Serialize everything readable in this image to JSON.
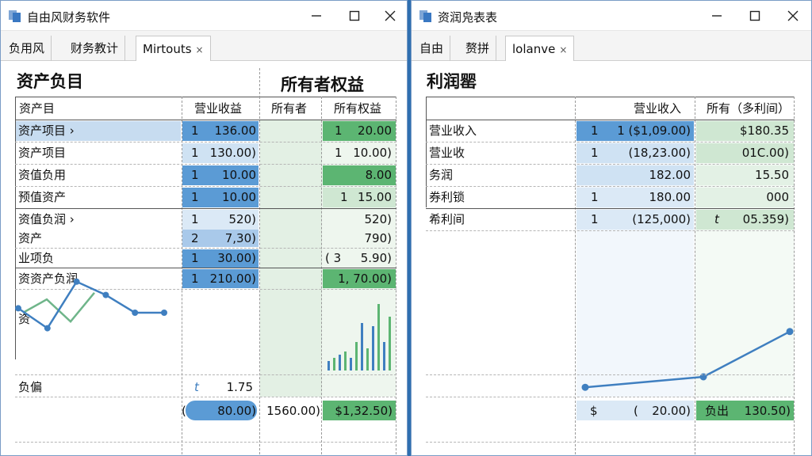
{
  "windows": [
    {
      "title": "自由风财务软件",
      "tabs": [
        {
          "label": "负用风"
        },
        {
          "label": "财务教计"
        },
        {
          "label": "Mirtouts",
          "close": "×"
        }
      ],
      "section_title": "资产负目",
      "equity_title": "所有者权益",
      "headers": {
        "account": "资产目",
        "col1": "营业收益",
        "col2": "所有者",
        "col3": "所有权益"
      },
      "rows": [
        {
          "label": "资产项目 ›",
          "c1_idx": "1",
          "c1_val": "136.00",
          "c3_idx": "1",
          "c3_val": "20.00"
        },
        {
          "label": "资产项目",
          "c1_idx": "1",
          "c1_val": "130.00)",
          "c3_idx": "1",
          "c3_val": "10.00)"
        },
        {
          "label": "资值负用",
          "c1_idx": "1",
          "c1_val": "10.00",
          "c3_idx": "",
          "c3_val": "8.00"
        },
        {
          "label": "预值资产",
          "c1_idx": "1",
          "c1_val": "10.00",
          "c3_idx": "1",
          "c3_val": "15.00"
        },
        {
          "label": "资值负润 ›",
          "c1_idx": "1",
          "c1_val": "520)",
          "c3_idx": "",
          "c3_val": "520)"
        },
        {
          "label": "资产",
          "c1_idx": "2",
          "c1_val": "7,30)",
          "c3_idx": "",
          "c3_val": "790)"
        },
        {
          "label": "业项负",
          "c1_idx": "1",
          "c1_val": "30.00)",
          "c3_idx": "( 3",
          "c3_val": "5.90)"
        },
        {
          "label": "资资产负润",
          "c1_idx": "1",
          "c1_val": "210.00)",
          "c3_idx": "",
          "c3_val": "1, 70.00)"
        }
      ],
      "chart_label": "资",
      "ratio_row": {
        "label": "负偏",
        "idx": "t",
        "val": "1.75"
      },
      "total_row": {
        "paren": "(",
        "c1": "80.00)",
        "c2": "1560.00)",
        "c3": "$1,32.50)"
      },
      "chart_data": [
        {
          "type": "line",
          "series": [
            {
              "values": [
                12,
                3,
                24,
                18,
                10,
                10
              ]
            },
            {
              "values": [
                10,
                16,
                6,
                19
              ]
            }
          ]
        },
        {
          "type": "bar",
          "values": [
            3,
            4,
            5,
            6,
            4,
            9,
            15,
            7,
            14,
            21,
            9,
            17
          ]
        }
      ]
    },
    {
      "title": "资润凫表表",
      "tabs": [
        {
          "label": "自由"
        },
        {
          "label": "赘拼"
        },
        {
          "label": "lolanve",
          "close": "×"
        }
      ],
      "section_title": "利润罂",
      "headers": {
        "col1": "营业收入",
        "col2": "所有（多利间）"
      },
      "rows": [
        {
          "label": "营业收入",
          "c1_idx": "1",
          "c1_val": "1 ($1,09.00)",
          "c2_val": "$180.35"
        },
        {
          "label": "营业收",
          "c1_idx": "1",
          "c1_val": "(18,23.00)",
          "c2_val": "01C.00)"
        },
        {
          "label": "务润",
          "c1_idx": "",
          "c1_val": "182.00",
          "c2_val": "15.50"
        },
        {
          "label": "券利锁",
          "c1_idx": "1",
          "c1_val": "180.00",
          "c2_val": "000"
        },
        {
          "label": "希利间",
          "c1_idx": "1",
          "c1_val": "(125,000)",
          "c2_idx": "t",
          "c2_val": "05.359)"
        }
      ],
      "total_row": {
        "dollar": "$",
        "paren": "(",
        "c1": "20.00)",
        "c2_label": "负出",
        "c2": "130.50)"
      },
      "chart_data": {
        "type": "line",
        "series": [
          {
            "values": [
              1,
              2.5,
              9
            ]
          }
        ]
      }
    }
  ],
  "colors": {
    "blue_strong": "#5b9bd5",
    "blue_light": "#cfe2f3",
    "green_strong": "#5cb572",
    "green_light": "#d8ecda",
    "line_blue": "#3f7fc0",
    "line_green": "#6fb58a"
  },
  "icons": {
    "app": "app-icon",
    "minimize": "minimize-icon",
    "maximize": "maximize-icon",
    "close": "close-icon"
  }
}
